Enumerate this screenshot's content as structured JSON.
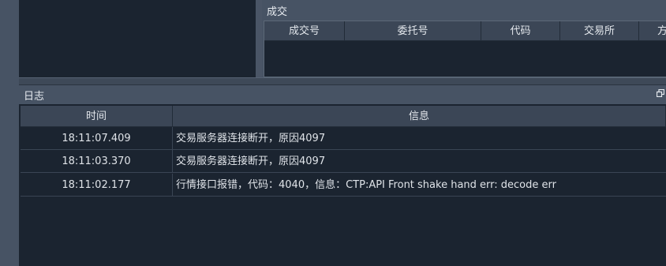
{
  "trades": {
    "title": "成交",
    "columns": [
      "成交号",
      "委托号",
      "代码",
      "交易所",
      "方"
    ]
  },
  "log": {
    "title": "日志",
    "float_icon": "float-window-icon",
    "columns": {
      "time": "时间",
      "message": "信息"
    },
    "rows": [
      {
        "time": "18:11:07.409",
        "message": "交易服务器连接断开，原因4097"
      },
      {
        "time": "18:11:03.370",
        "message": "交易服务器连接断开，原因4097"
      },
      {
        "time": "18:11:02.177",
        "message": "行情接口报错，代码：4040，信息：CTP:API Front shake hand err: decode err"
      }
    ]
  },
  "colors": {
    "panel_bg": "#1b2430",
    "chrome_bg": "#475364",
    "header_bg": "#3b4656",
    "text": "#dfe3e8"
  }
}
